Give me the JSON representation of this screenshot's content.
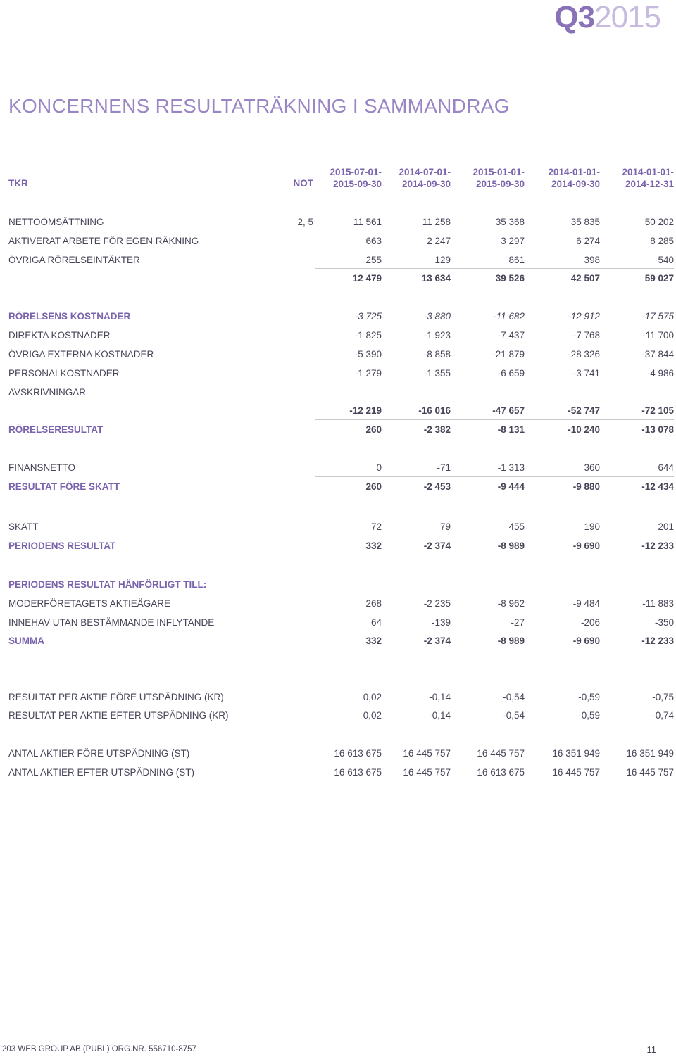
{
  "brand": {
    "quarter": "Q3",
    "year": "2015"
  },
  "title": "KONCERNENS RESULTATRÄKNING I SAMMANDRAG",
  "header": {
    "tkr": "TKR",
    "not": "NOT",
    "periods": [
      {
        "from": "2015-07-01-",
        "to": "2015-09-30"
      },
      {
        "from": "2014-07-01-",
        "to": "2014-09-30"
      },
      {
        "from": "2015-01-01-",
        "to": "2015-09-30"
      },
      {
        "from": "2014-01-01-",
        "to": "2014-09-30"
      },
      {
        "from": "2014-01-01-",
        "to": "2014-12-31"
      }
    ]
  },
  "rows": [
    {
      "label": "NETTOOMSÄTTNING",
      "note": "2, 5",
      "values": [
        "11 561",
        "11 258",
        "35 368",
        "35 835",
        "50 202"
      ]
    },
    {
      "label": "AKTIVERAT ARBETE FÖR EGEN RÄKNING",
      "note": "",
      "values": [
        "663",
        "2 247",
        "3 297",
        "6 274",
        "8 285"
      ]
    },
    {
      "label": "ÖVRIGA RÖRELSEINTÄKTER",
      "note": "",
      "values": [
        "255",
        "129",
        "861",
        "398",
        "540"
      ]
    },
    {
      "label": "",
      "note": "",
      "values": [
        "12 479",
        "13 634",
        "39 526",
        "42 507",
        "59 027"
      ]
    },
    {
      "label": "RÖRELSENS KOSTNADER",
      "note": "",
      "values": [
        "-3 725",
        "-3 880",
        "-11 682",
        "-12 912",
        "-17 575"
      ]
    },
    {
      "label": "DIREKTA KOSTNADER",
      "note": "",
      "values": [
        "-1 825",
        "-1 923",
        "-7 437",
        "-7 768",
        "-11 700"
      ]
    },
    {
      "label": "ÖVRIGA EXTERNA KOSTNADER",
      "note": "",
      "values": [
        "-5 390",
        "-8 858",
        "-21 879",
        "-28 326",
        "-37 844"
      ]
    },
    {
      "label": "PERSONALKOSTNADER",
      "note": "",
      "values": [
        "-1 279",
        "-1 355",
        "-6 659",
        "-3 741",
        "-4 986"
      ]
    },
    {
      "label": "AVSKRIVNINGAR",
      "note": "",
      "values": [
        "",
        "",
        "",
        "",
        ""
      ]
    },
    {
      "label": "",
      "note": "",
      "values": [
        "-12 219",
        "-16 016",
        "-47 657",
        "-52 747",
        "-72 105"
      ]
    },
    {
      "label": "RÖRELSERESULTAT",
      "note": "",
      "values": [
        "260",
        "-2 382",
        "-8 131",
        "-10 240",
        "-13 078"
      ]
    },
    {
      "label": "FINANSNETTO",
      "note": "",
      "values": [
        "0",
        "-71",
        "-1 313",
        "360",
        "644"
      ]
    },
    {
      "label": "RESULTAT FÖRE SKATT",
      "note": "",
      "values": [
        "260",
        "-2 453",
        "-9 444",
        "-9 880",
        "-12 434"
      ]
    },
    {
      "label": "SKATT",
      "note": "",
      "values": [
        "72",
        "79",
        "455",
        "190",
        "201"
      ]
    },
    {
      "label": "PERIODENS RESULTAT",
      "note": "",
      "values": [
        "332",
        "-2 374",
        "-8 989",
        "-9 690",
        "-12 233"
      ]
    },
    {
      "label": "PERIODENS RESULTAT HÄNFÖRLIGT TILL:",
      "note": "",
      "values": [
        "",
        "",
        "",
        "",
        ""
      ]
    },
    {
      "label": "MODERFÖRETAGETS AKTIEÄGARE",
      "note": "",
      "values": [
        "268",
        "-2 235",
        "-8 962",
        "-9 484",
        "-11 883"
      ]
    },
    {
      "label": "INNEHAV UTAN BESTÄMMANDE INFLYTANDE",
      "note": "",
      "values": [
        "64",
        "-139",
        "-27",
        "-206",
        "-350"
      ]
    },
    {
      "label": "SUMMA",
      "note": "",
      "values": [
        "332",
        "-2 374",
        "-8 989",
        "-9 690",
        "-12 233"
      ]
    },
    {
      "label": "RESULTAT PER AKTIE FÖRE UTSPÄDNING (KR)",
      "note": "",
      "values": [
        "0,02",
        "-0,14",
        "-0,54",
        "-0,59",
        "-0,75"
      ]
    },
    {
      "label": "RESULTAT PER AKTIE EFTER UTSPÄDNING (KR)",
      "note": "",
      "values": [
        "0,02",
        "-0,14",
        "-0,54",
        "-0,59",
        "-0,74"
      ]
    },
    {
      "label": "ANTAL AKTIER FÖRE UTSPÄDNING (ST)",
      "note": "",
      "values": [
        "16 613 675",
        "16 445 757",
        "16 445 757",
        "16 351 949",
        "16 351 949"
      ]
    },
    {
      "label": "ANTAL AKTIER EFTER UTSPÄDNING (ST)",
      "note": "",
      "values": [
        "16 613 675",
        "16 445 757",
        "16 613 675",
        "16 445 757",
        "16 445 757"
      ]
    }
  ],
  "footer": {
    "company": "203 WEB GROUP AB (PUBL) ORG.NR. 556710-8757",
    "page": "11"
  }
}
